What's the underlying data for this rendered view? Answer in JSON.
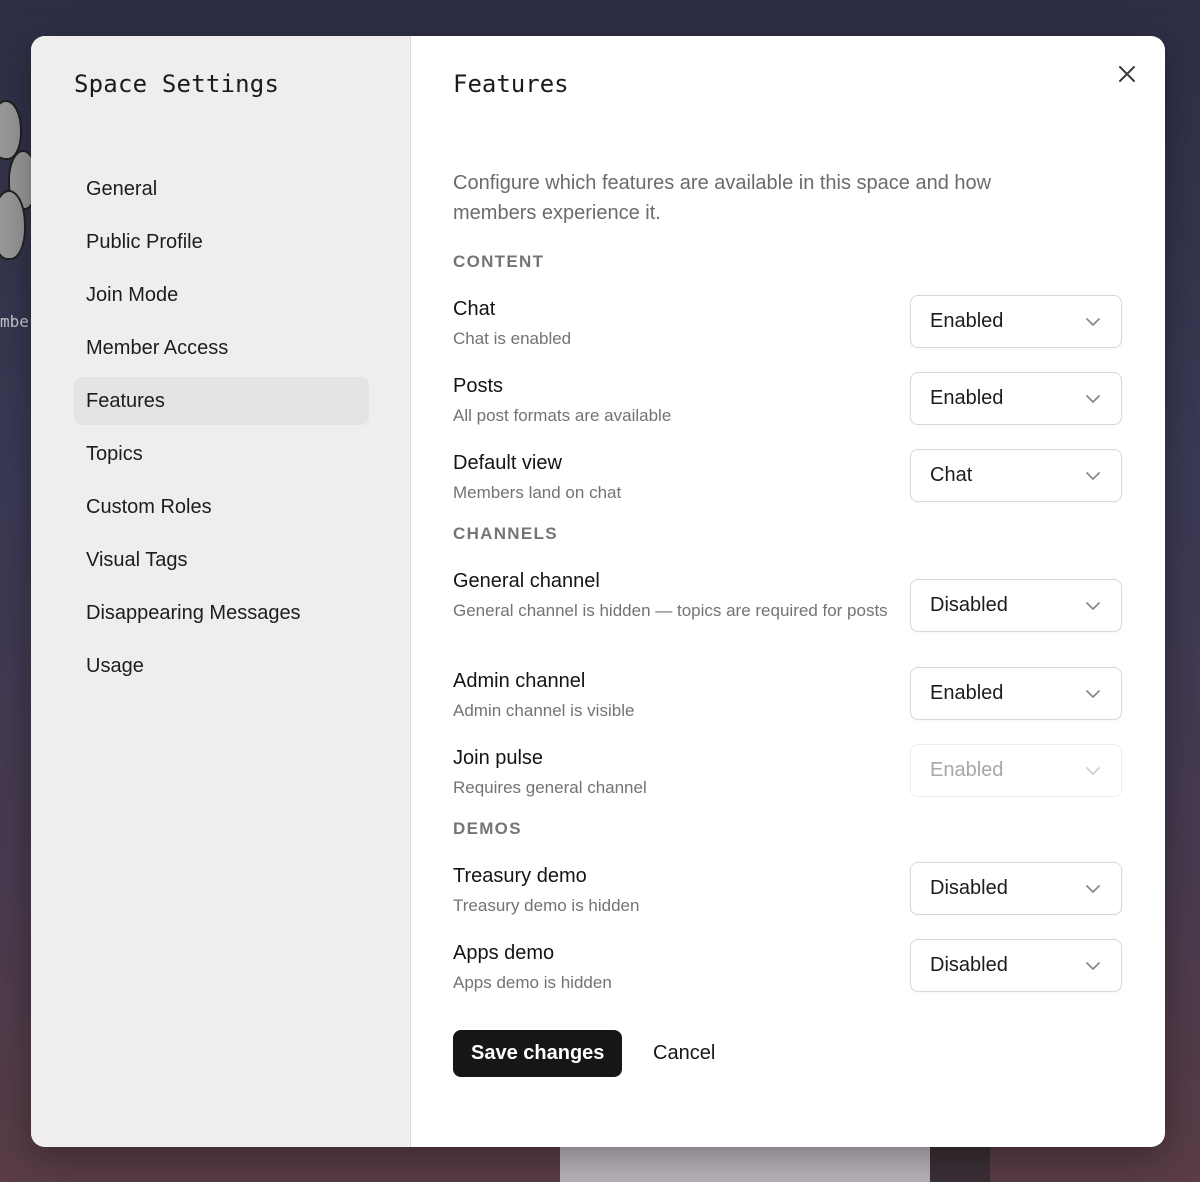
{
  "background": {
    "peek_text": "mbe"
  },
  "sidebar": {
    "title": "Space Settings",
    "items": [
      {
        "label": "General"
      },
      {
        "label": "Public Profile"
      },
      {
        "label": "Join Mode"
      },
      {
        "label": "Member Access"
      },
      {
        "label": "Features",
        "active": true
      },
      {
        "label": "Topics"
      },
      {
        "label": "Custom Roles"
      },
      {
        "label": "Visual Tags"
      },
      {
        "label": "Disappearing Messages"
      },
      {
        "label": "Usage"
      }
    ]
  },
  "main": {
    "title": "Features",
    "close_icon": "close-icon",
    "description": "Configure which features are available in this space and how members experience it.",
    "sections": {
      "content": "CONTENT",
      "channels": "CHANNELS",
      "demos": "DEMOS"
    },
    "rows": {
      "chat": {
        "title": "Chat",
        "subtitle": "Chat is enabled",
        "value": "Enabled"
      },
      "posts": {
        "title": "Posts",
        "subtitle": "All post formats are available",
        "value": "Enabled"
      },
      "default_view": {
        "title": "Default view",
        "subtitle": "Members land on chat",
        "value": "Chat"
      },
      "general_channel": {
        "title": "General channel",
        "subtitle": "General channel is hidden — topics are required for posts",
        "value": "Disabled"
      },
      "admin_channel": {
        "title": "Admin channel",
        "subtitle": "Admin channel is visible",
        "value": "Enabled"
      },
      "join_pulse": {
        "title": "Join pulse",
        "subtitle": "Requires general channel",
        "value": "Enabled",
        "disabled": true
      },
      "treasury_demo": {
        "title": "Treasury demo",
        "subtitle": "Treasury demo is hidden",
        "value": "Disabled"
      },
      "apps_demo": {
        "title": "Apps demo",
        "subtitle": "Apps demo is hidden",
        "value": "Disabled"
      }
    },
    "actions": {
      "save_label": "Save changes",
      "cancel_label": "Cancel"
    }
  },
  "colors": {
    "sidebar_bg": "#efeeed",
    "primary_button": "#161616",
    "muted_text": "#737373"
  }
}
